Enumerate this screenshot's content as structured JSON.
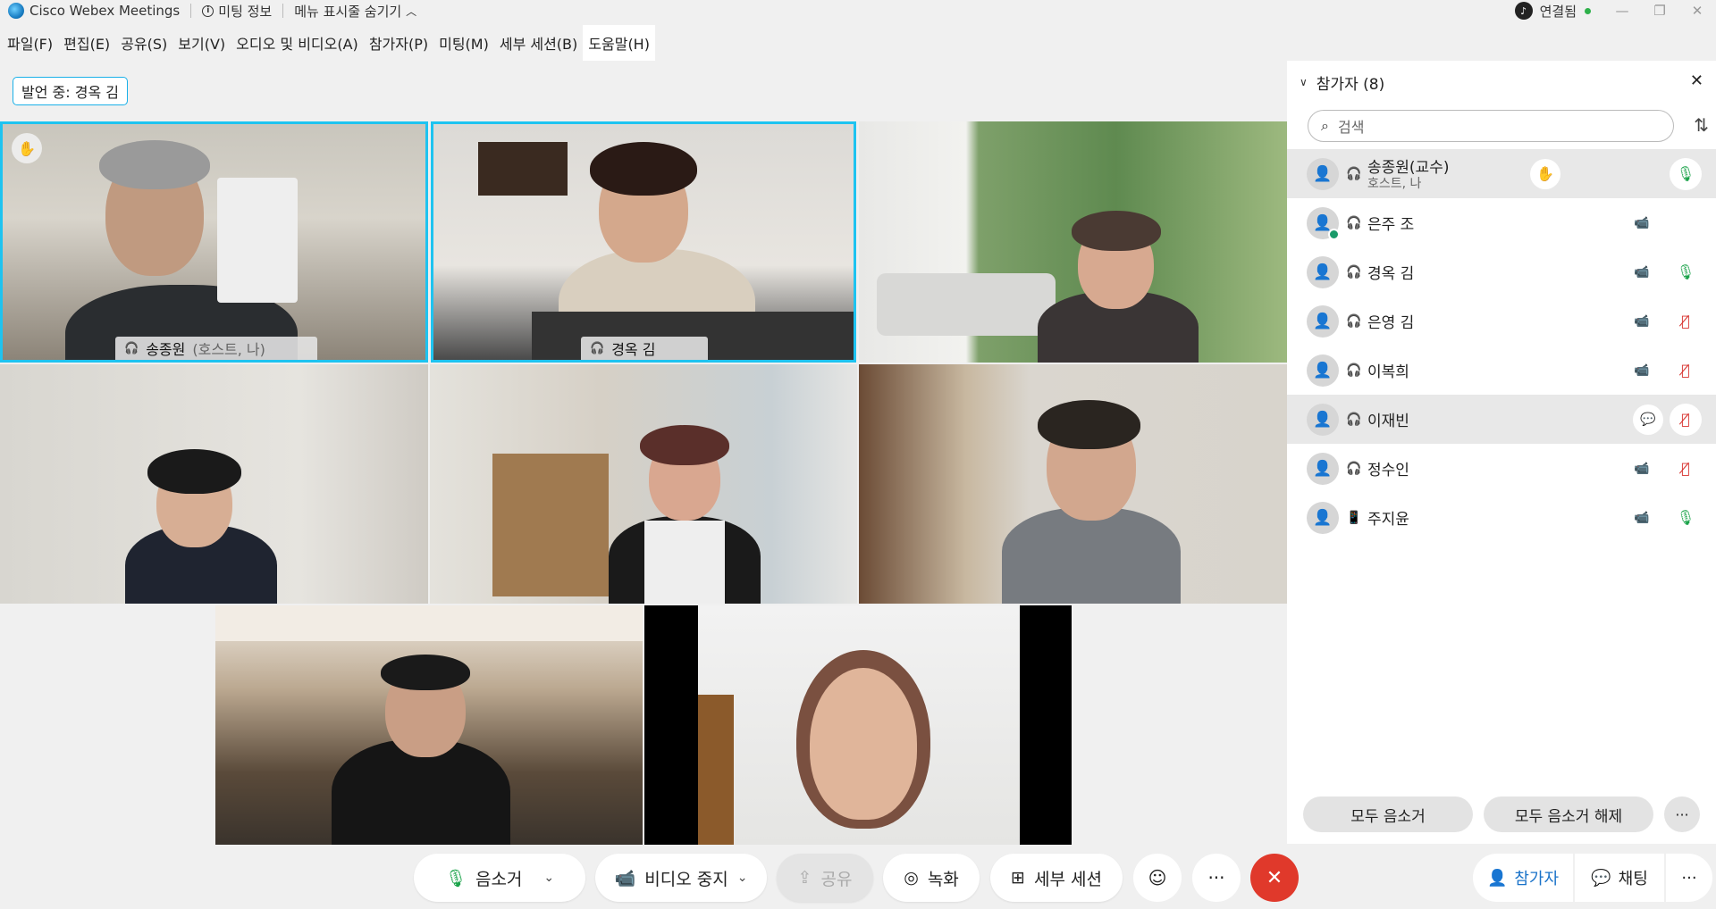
{
  "titlebar": {
    "app_name": "Cisco Webex Meetings",
    "meeting_info": "미팅 정보",
    "hide_menu": "메뉴 표시줄 숨기기",
    "connection": "연결됨"
  },
  "menu": [
    "파일(F)",
    "편집(E)",
    "공유(S)",
    "보기(V)",
    "오디오 및 비디오(A)",
    "참가자(P)",
    "미팅(M)",
    "세부 세션(B)",
    "도움말(H)"
  ],
  "speaker_badge": "발언 중: 경옥 김",
  "videos": {
    "tile1_name": "송종원",
    "tile1_sub": "(호스트, 나)",
    "tile2_name": "경옥 김"
  },
  "toolbar": {
    "mute": "음소거",
    "video_stop": "비디오 중지",
    "share": "공유",
    "record": "녹화",
    "breakout": "세부 세션",
    "more": "···",
    "participants": "참가자",
    "chat": "채팅"
  },
  "panel": {
    "title": "참가자 (8)",
    "search_placeholder": "검색",
    "mute_all": "모두 음소거",
    "unmute_all": "모두 음소거 해제",
    "more": "···",
    "participants": [
      {
        "name": "송종원(교수)",
        "sub": "호스트, 나",
        "mic": "on"
      },
      {
        "name": "은주 조",
        "sub": "",
        "mic": "none"
      },
      {
        "name": "경옥 김",
        "sub": "",
        "mic": "on"
      },
      {
        "name": "은영 김",
        "sub": "",
        "mic": "off"
      },
      {
        "name": "이복희",
        "sub": "",
        "mic": "off"
      },
      {
        "name": "이재빈",
        "sub": "",
        "mic": "off"
      },
      {
        "name": "정수인",
        "sub": "",
        "mic": "off"
      },
      {
        "name": "주지윤",
        "sub": "",
        "mic": "on"
      }
    ]
  },
  "colors": {
    "active_speaker": "#1ec3f0",
    "end_call": "#e0392b",
    "mic_on": "#1ba34a",
    "mic_off": "#d8322e"
  }
}
